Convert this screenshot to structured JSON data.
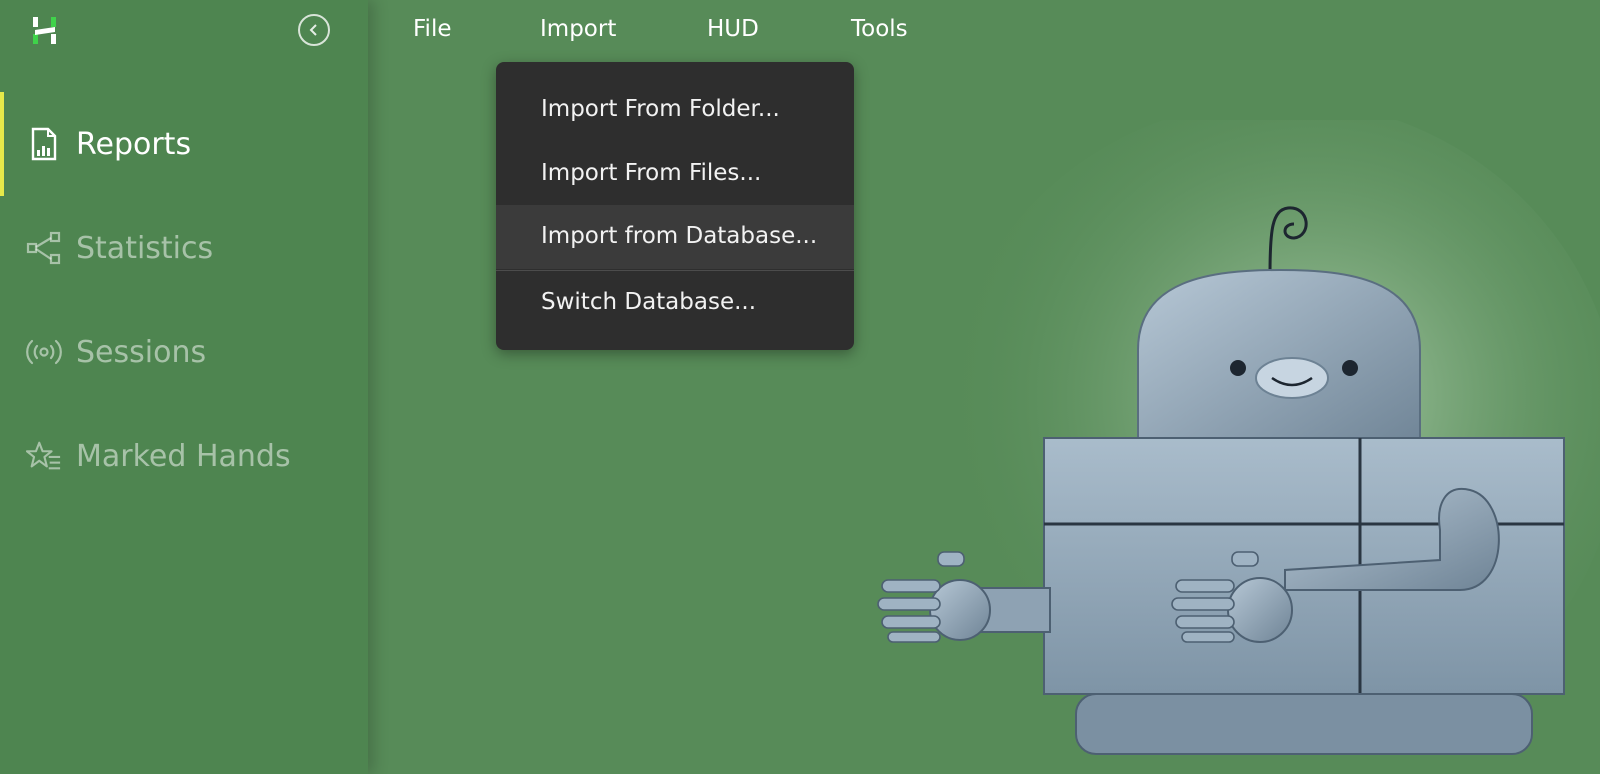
{
  "sidebar": {
    "items": [
      {
        "label": "Reports",
        "icon": "report-icon",
        "active": true
      },
      {
        "label": "Statistics",
        "icon": "share-nodes-icon",
        "active": false
      },
      {
        "label": "Sessions",
        "icon": "broadcast-icon",
        "active": false
      },
      {
        "label": "Marked Hands",
        "icon": "star-list-icon",
        "active": false
      }
    ]
  },
  "menubar": {
    "items": [
      "File",
      "Import",
      "HUD",
      "Tools"
    ]
  },
  "import_menu": {
    "items": [
      "Import From Folder...",
      "Import From Files...",
      "Import from Database...",
      "Switch Database..."
    ],
    "hovered": "Import from Database..."
  },
  "colors": {
    "background": "#578b58",
    "sidebar": "#4e8550",
    "active_indicator": "#e6e94a",
    "menu_background": "#2e2e2e",
    "menu_hover": "#3b3b3b"
  }
}
